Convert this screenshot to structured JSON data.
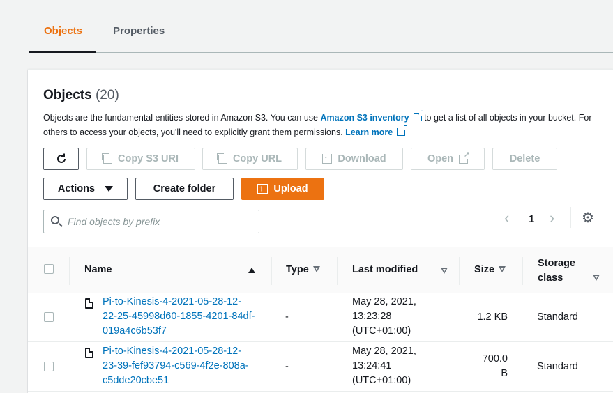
{
  "tabs": [
    {
      "label": "Objects"
    },
    {
      "label": "Properties"
    }
  ],
  "header": {
    "title": "Objects",
    "count": "(20)"
  },
  "description": {
    "part1": "Objects are the fundamental entities stored in Amazon S3. You can use ",
    "inventory_link": "Amazon S3 inventory",
    "part2": " to get a list of all objects in your bucket. For others to access your objects, you'll need to explicitly grant them permissions. ",
    "learn_more": "Learn more"
  },
  "toolbar": {
    "copy_uri": "Copy S3 URI",
    "copy_url": "Copy URL",
    "download": "Download",
    "open": "Open",
    "delete": "Delete",
    "actions": "Actions",
    "create_folder": "Create folder",
    "upload": "Upload"
  },
  "search": {
    "placeholder": "Find objects by prefix"
  },
  "pagination": {
    "page": "1"
  },
  "columns": {
    "name": "Name",
    "type": "Type",
    "last_modified": "Last modified",
    "size": "Size",
    "storage_class_1": "Storage",
    "storage_class_2": "class"
  },
  "rows": [
    {
      "name_lines": [
        "Pi-to-Kinesis-4-2021-05-28-12-",
        "22-25-45998d60-1855-4201-84df-",
        "019a4c6b53f7"
      ],
      "type": "-",
      "modified_lines": [
        "May 28, 2021,",
        "13:23:28",
        "(UTC+01:00)"
      ],
      "size_lines": [
        "1.2 KB"
      ],
      "storage": "Standard"
    },
    {
      "name_lines": [
        "Pi-to-Kinesis-4-2021-05-28-12-",
        "23-39-fef93794-c569-4f2e-808a-",
        "c5dde20cbe51"
      ],
      "type": "-",
      "modified_lines": [
        "May 28, 2021,",
        "13:24:41",
        "(UTC+01:00)"
      ],
      "size_lines": [
        "700.0",
        "B"
      ],
      "storage": "Standard"
    }
  ],
  "colors": {
    "accent": "#ec7211",
    "link": "#0073bb",
    "text": "#16191f"
  },
  "icons": {
    "refresh": "refresh-icon",
    "copy": "copy-icon",
    "download": "download-icon",
    "external": "external-link-icon",
    "upload": "upload-icon",
    "search": "search-icon",
    "settings": "gear-icon",
    "file": "file-icon"
  }
}
